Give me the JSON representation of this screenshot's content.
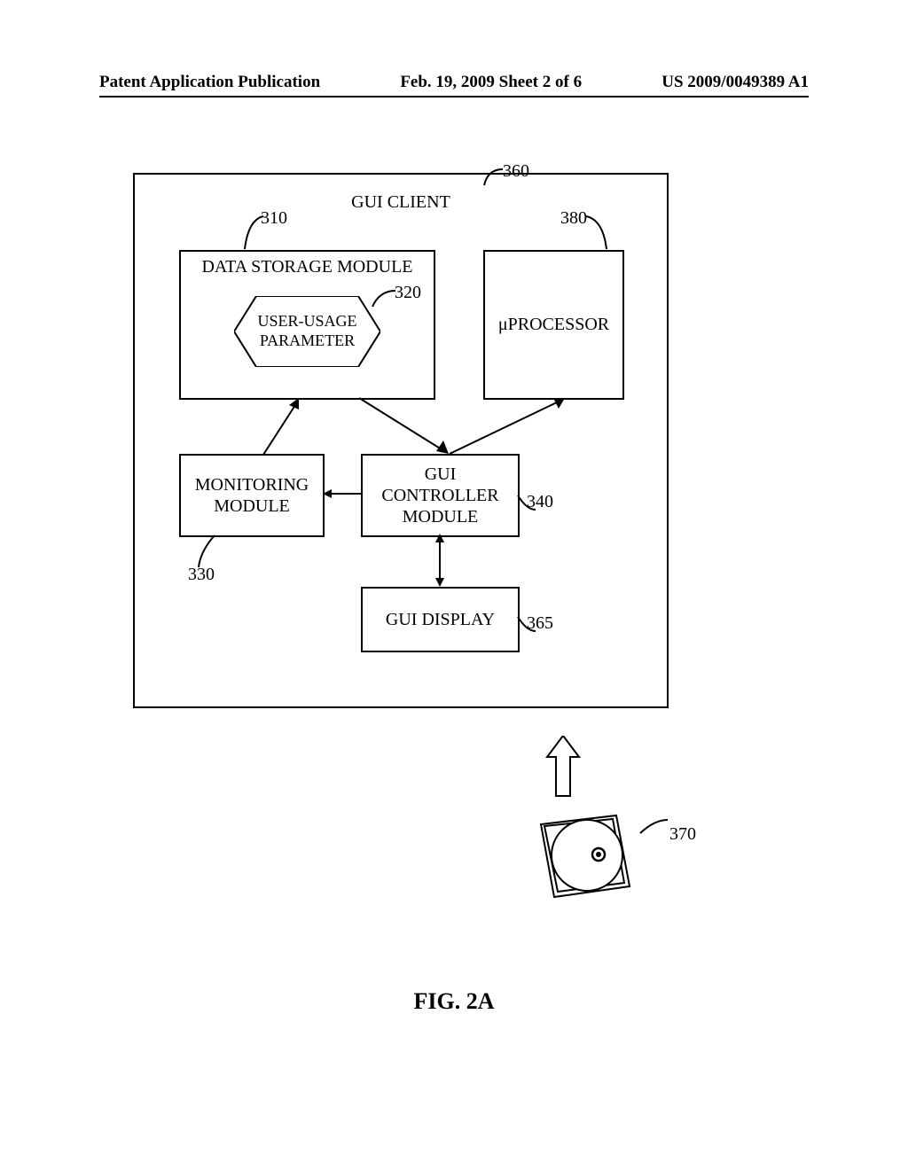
{
  "header": {
    "left": "Patent Application Publication",
    "center": "Feb. 19, 2009  Sheet 2 of 6",
    "right": "US 2009/0049389 A1"
  },
  "diagram": {
    "title": "GUI CLIENT",
    "data_storage": "DATA STORAGE MODULE",
    "user_usage_line1": "USER-USAGE",
    "user_usage_line2": "PARAMETER",
    "processor": "μPROCESSOR",
    "monitoring_line1": "MONITORING",
    "monitoring_line2": "MODULE",
    "gui_controller_line1": "GUI",
    "gui_controller_line2": "CONTROLLER",
    "gui_controller_line3": "MODULE",
    "gui_display": "GUI DISPLAY"
  },
  "refs": {
    "r360": "360",
    "r310": "310",
    "r380": "380",
    "r320": "320",
    "r340": "340",
    "r330": "330",
    "r365": "365",
    "r370": "370"
  },
  "figure_label": "FIG. 2A"
}
